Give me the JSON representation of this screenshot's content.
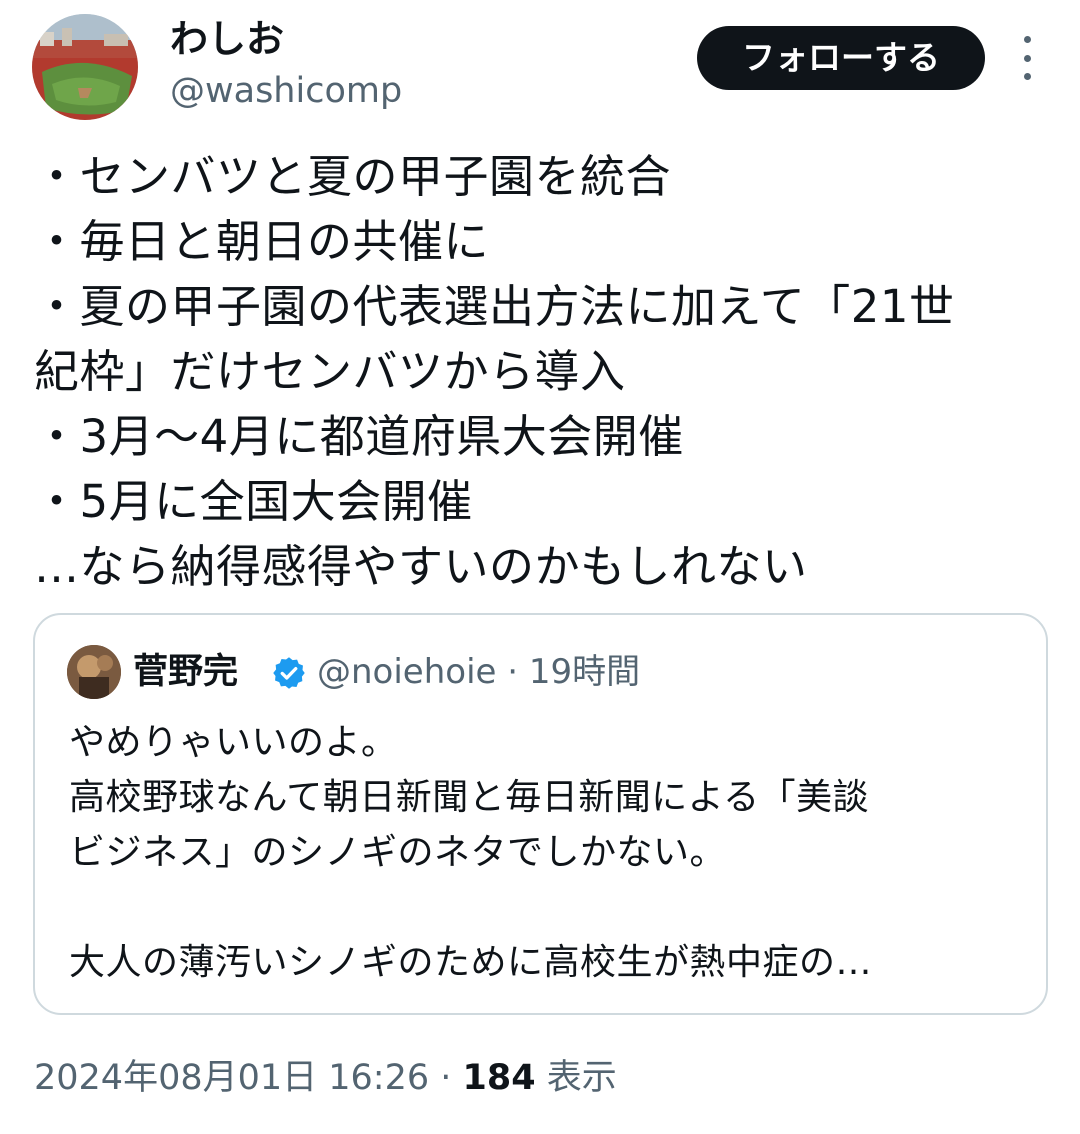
{
  "author": {
    "display_name": "わしお",
    "handle": "@washicomp",
    "avatar_icon": "baseball-stadium-avatar"
  },
  "follow_label": "フォローする",
  "more_icon": "more-vertical-icon",
  "tweet_lines": [
    "・センバツと夏の甲子園を統合",
    "・毎日と朝日の共催に",
    "・夏の甲子園の代表選出方法に加えて「21世",
    "紀枠」だけセンバツから導入",
    "・3月〜4月に都道府県大会開催",
    "・5月に全国大会開催",
    "…なら納得感得やすいのかもしれない"
  ],
  "quote": {
    "display_name": "菅野完",
    "verified_icon": "verified-badge-icon",
    "verified_color": "#1d9bf0",
    "handle_time": "@noiehoie · 19時間",
    "text_lines": [
      "やめりゃいいのよ。",
      "高校野球なんて朝日新聞と毎日新聞による「美談",
      "ビジネス」のシノギのネタでしかない。",
      "",
      "大人の薄汚いシノギのために高校生が熱中症の…"
    ]
  },
  "meta": {
    "timestamp": "2024年08月01日 16:26",
    "separator": " · ",
    "views_count": "184",
    "views_label": " 表示"
  }
}
